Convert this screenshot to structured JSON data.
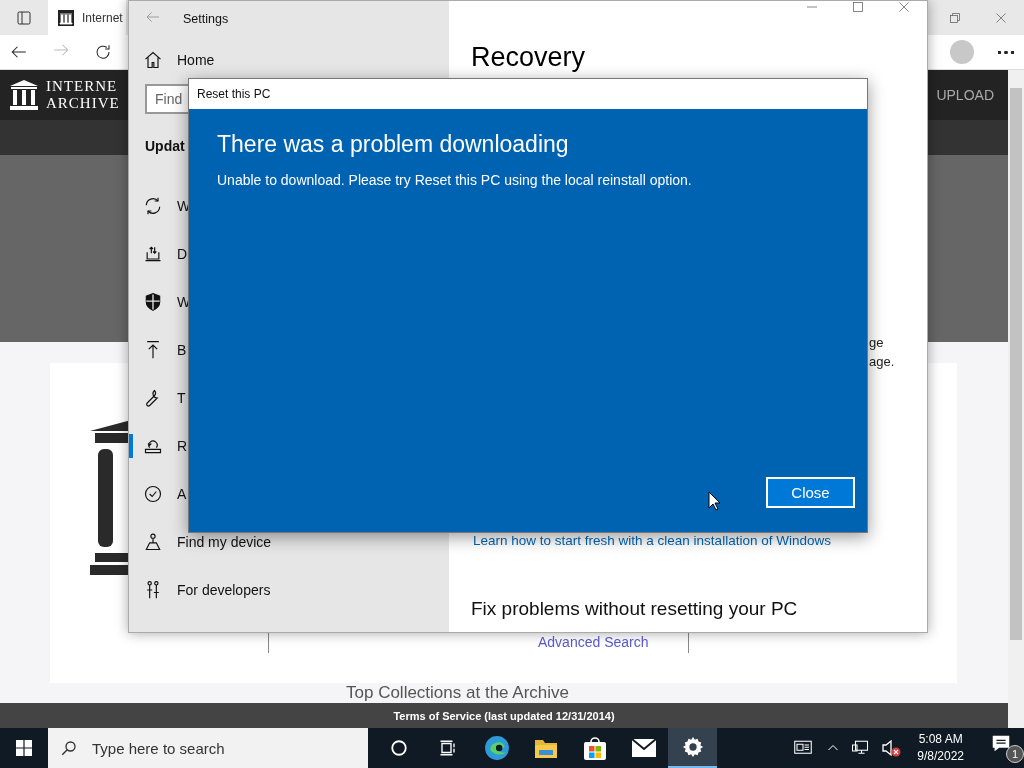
{
  "browser": {
    "tab_title": "Internet",
    "site": {
      "logo_line_1": "INTERNE",
      "logo_line_2": "ARCHIVE",
      "upload": "UPLOAD",
      "advanced_search": "Advanced Search",
      "section_heading": "Top Collections at the Archive",
      "footer_link": "Terms of Service (last updated 12/31/2014)"
    }
  },
  "settings": {
    "title": "Settings",
    "home": "Home",
    "search_placeholder": "Find",
    "section": "Updat",
    "nav": [
      {
        "kind": "sync",
        "label": "W",
        "selected": false
      },
      {
        "kind": "delivery",
        "label": "D",
        "selected": false
      },
      {
        "kind": "shield",
        "label": "W",
        "selected": false
      },
      {
        "kind": "backup",
        "label": "B",
        "selected": false
      },
      {
        "kind": "wrench",
        "label": "T",
        "selected": false
      },
      {
        "kind": "recovery",
        "label": "R",
        "selected": true
      },
      {
        "kind": "activation",
        "label": "A",
        "selected": false
      },
      {
        "kind": "find",
        "label": "Find my device",
        "selected": false
      },
      {
        "kind": "developers",
        "label": "For developers",
        "selected": false
      }
    ],
    "page_title": "Recovery",
    "text_fragments": [
      "ge",
      "age."
    ],
    "link": "Learn how to start fresh with a clean installation of Windows",
    "heading": "Fix problems without resetting your PC"
  },
  "dialog": {
    "title": "Reset this PC",
    "heading": "There was a problem downloading",
    "message": "Unable to download. Please try Reset this PC using the local reinstall option.",
    "button": "Close"
  },
  "taskbar": {
    "search_placeholder": "Type here to search",
    "buttons": [
      {
        "kind": "cortana",
        "selected": false
      },
      {
        "kind": "task-view",
        "selected": false
      },
      {
        "kind": "edge",
        "selected": false
      },
      {
        "kind": "explorer",
        "selected": false
      },
      {
        "kind": "store",
        "selected": false
      },
      {
        "kind": "mail",
        "selected": false
      },
      {
        "kind": "settings",
        "selected": true
      }
    ],
    "volume_muted": true,
    "time": "5:08 AM",
    "date": "9/8/2022",
    "notification_count": "1"
  }
}
